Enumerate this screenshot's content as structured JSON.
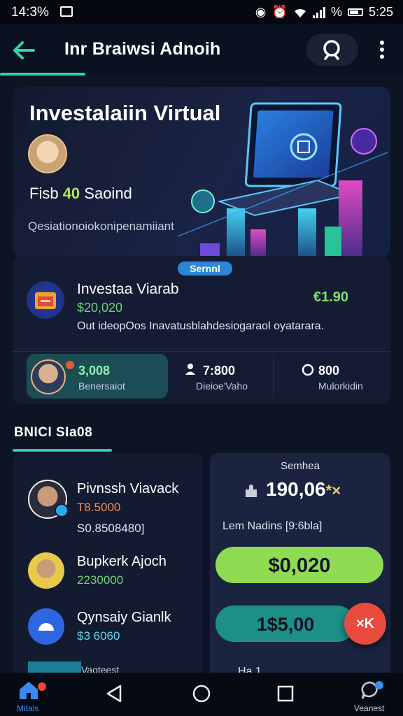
{
  "status_bar": {
    "time": "14:3%",
    "battery_percent": "%",
    "clock_right": "5:25"
  },
  "app_bar": {
    "title": "Inr Braiwsi Adnoih"
  },
  "hero": {
    "title": "Investalaiin Virtual",
    "fund_prefix": "Fisb ",
    "fund_highlight": "40",
    "fund_suffix": " Saoind",
    "description": "Qesiationoiokonipenamiiant"
  },
  "card": {
    "pill": "Sernnl",
    "title": "Investaa Viarab",
    "value": "$20,020",
    "right_value": "€1.90",
    "description": "Out ideopOos Inavatusblahdesiogaraol oyatarara.",
    "stats": [
      {
        "value": "3,008",
        "label": "Benersaiot"
      },
      {
        "value": "7:800",
        "label": "Dieioe'Vaho"
      },
      {
        "value": "800",
        "label": "Mulorkidin"
      }
    ]
  },
  "section": {
    "title": "BNICI SIa08"
  },
  "list": {
    "items": [
      {
        "name": "Pivnssh Viavack",
        "line1": "T8.5000",
        "line2": "S0.8508480]"
      },
      {
        "name": "Bupkerk Ajoch",
        "line1": "2230000"
      },
      {
        "name": "Qynsaiy Gianlk",
        "line1": "$3 6060"
      }
    ],
    "peek_text": "Vaoteest"
  },
  "panel": {
    "title": "Semhea",
    "big_value": "190,06",
    "big_accent": "*×",
    "label": "Lem Nadins [9:6bla]",
    "button1": "$0,020",
    "button2": "1$5,00",
    "fab": "×K",
    "peek_text": "Ha 1"
  },
  "nav": {
    "home_label": "Mitals",
    "chat_label": "Veanest"
  },
  "colors": {
    "accent_green": "#8fdc53",
    "teal": "#1c8f86",
    "fab_red": "#e84a3e",
    "background": "#0d1424"
  }
}
